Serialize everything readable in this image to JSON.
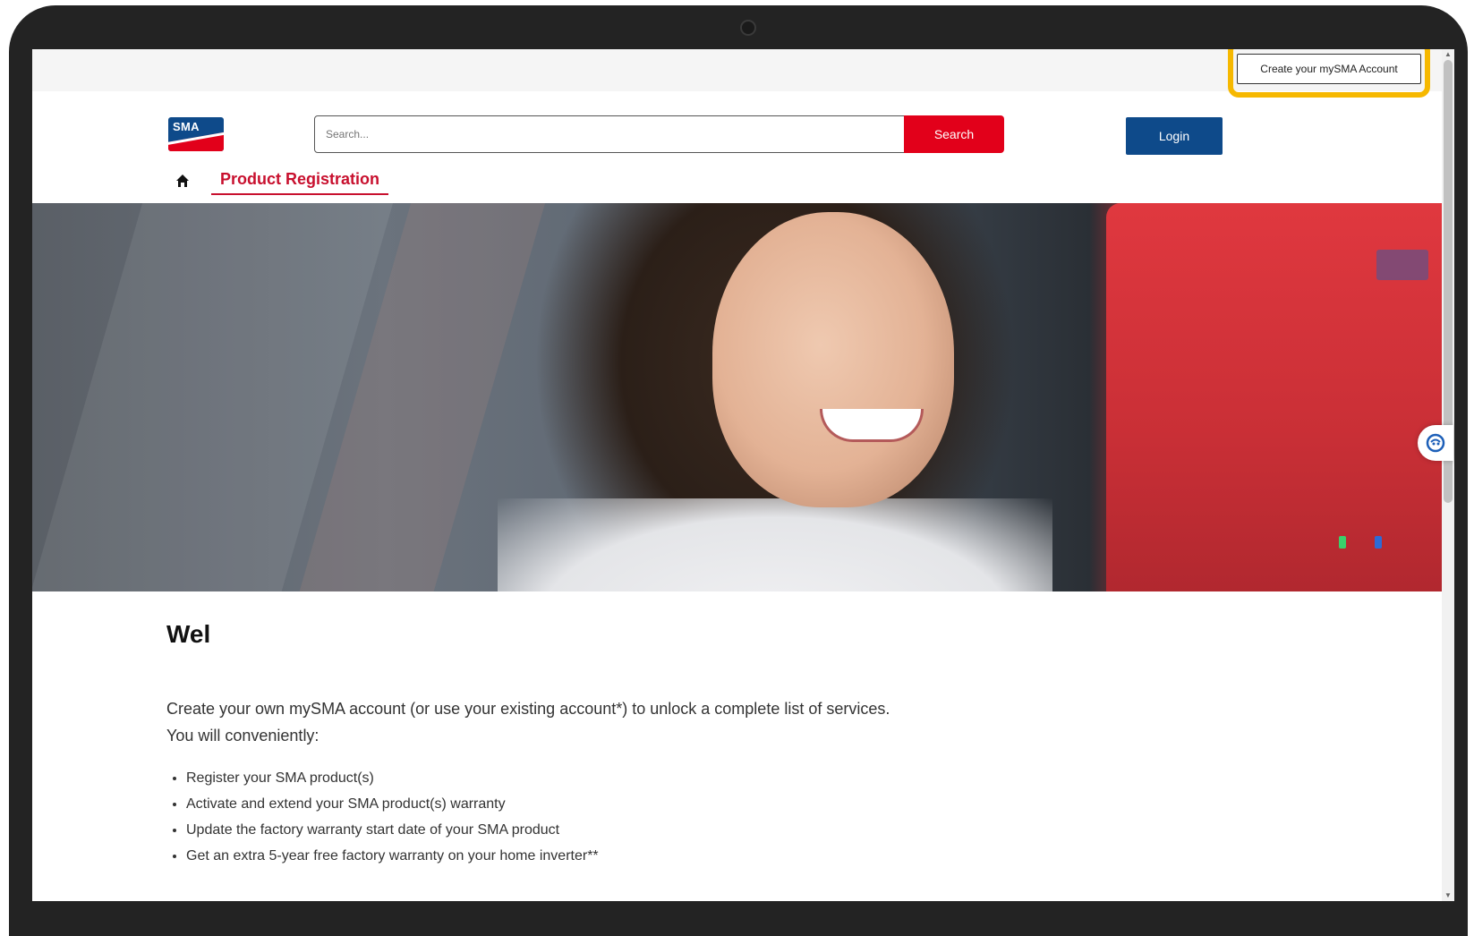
{
  "topbar": {
    "create_account_label": "Create your mySMA Account"
  },
  "header": {
    "logo_text": "SMA",
    "search_placeholder": "Search...",
    "search_button": "Search",
    "login_button": "Login"
  },
  "nav": {
    "active_tab": "Product Registration"
  },
  "content": {
    "welcome_heading": "Wel",
    "intro_line1": "Create your own mySMA account (or use your existing account*) to unlock a complete list of services.",
    "intro_line2": "You will conveniently:",
    "benefits": [
      "Register your SMA product(s)",
      "Activate and extend your SMA product(s) warranty",
      "Update the factory warranty start date of your SMA product",
      "Get an extra 5-year free factory warranty on your home inverter**"
    ]
  },
  "colors": {
    "brand_red": "#e2001a",
    "brand_blue": "#0e4a8a",
    "highlight_yellow": "#f6b800"
  },
  "icons": [
    "home-icon",
    "chat-icon"
  ]
}
